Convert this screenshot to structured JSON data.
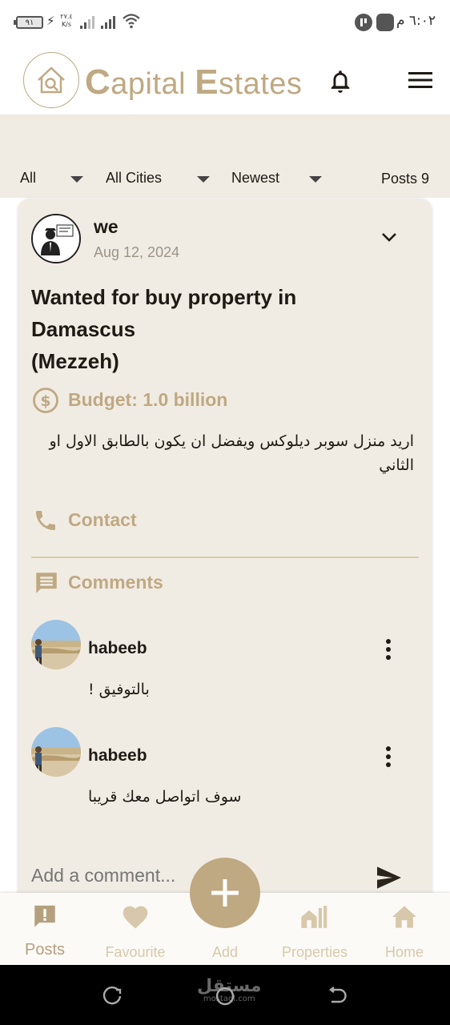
{
  "status_bar": {
    "battery": "٩١",
    "speed_value": "٢٧.٤",
    "speed_unit": "K/s",
    "time": "٦:٠٢ م"
  },
  "header": {
    "logo_first_initial": "C",
    "logo_first_rest": "apital ",
    "logo_second_initial": "E",
    "logo_second_rest": "states",
    "icons": [
      "home-search-icon",
      "bell-icon",
      "hamburger-menu-icon"
    ],
    "accent_color": "#bfa983"
  },
  "filters": {
    "type": "All",
    "city": "All Cities",
    "sort": "Newest",
    "posts_count": "Posts 9"
  },
  "post": {
    "user_name": "we",
    "date": "Aug 12, 2024",
    "title": "Wanted for buy  property in\nDamascus\n (Mezzeh)",
    "budget": "Budget: 1.0 billion",
    "description": "اريد منزل سوبر ديلوكس ويفضل ان يكون بالطابق الاول او الثاني",
    "contact_label": "Contact",
    "comments_label": "Comments"
  },
  "comments": [
    {
      "name": "habeeb",
      "text": "بالتوفيق !"
    },
    {
      "name": "habeeb",
      "text": "سوف اتواصل معك قريبا"
    }
  ],
  "comment_input": {
    "placeholder": "Add a comment..."
  },
  "bottom_nav": {
    "items": [
      {
        "label": "Posts",
        "icon": "alert-box-icon",
        "active": true
      },
      {
        "label": "Favourite",
        "icon": "heart-icon",
        "active": false
      },
      {
        "label": "Add",
        "icon": "plus-icon",
        "active": false
      },
      {
        "label": "Properties",
        "icon": "buildings-icon",
        "active": false
      },
      {
        "label": "Home",
        "icon": "home-icon",
        "active": false
      }
    ]
  },
  "watermark": {
    "brand": "مستقل",
    "domain": "mostaql.com"
  }
}
